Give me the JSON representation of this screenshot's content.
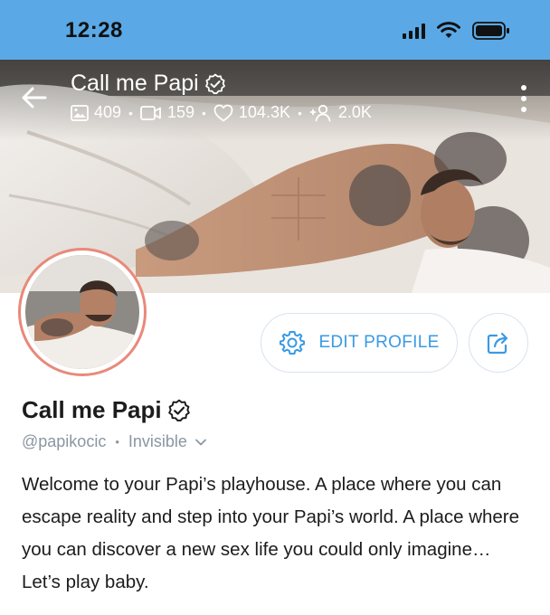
{
  "status_bar": {
    "time": "12:28"
  },
  "cover": {
    "title": "Call me Papi",
    "stats": {
      "photos": "409",
      "videos": "159",
      "likes": "104.3K",
      "fans": "2.0K"
    }
  },
  "actions": {
    "edit_profile_label": "EDIT PROFILE"
  },
  "profile": {
    "name": "Call me Papi",
    "handle": "@papikocic",
    "separator": "•",
    "visibility": "Invisible",
    "bio": "Welcome to your Papi’s playhouse. A place where you can escape reality and step into your Papi’s world. A place where you can discover a new sex life you could only imagine… Let’s play baby."
  },
  "colors": {
    "status_bar_bg": "#5aa9e6",
    "accent": "#3a9ae4",
    "avatar_ring": "#e9897a",
    "muted_text": "#8a96a3"
  }
}
